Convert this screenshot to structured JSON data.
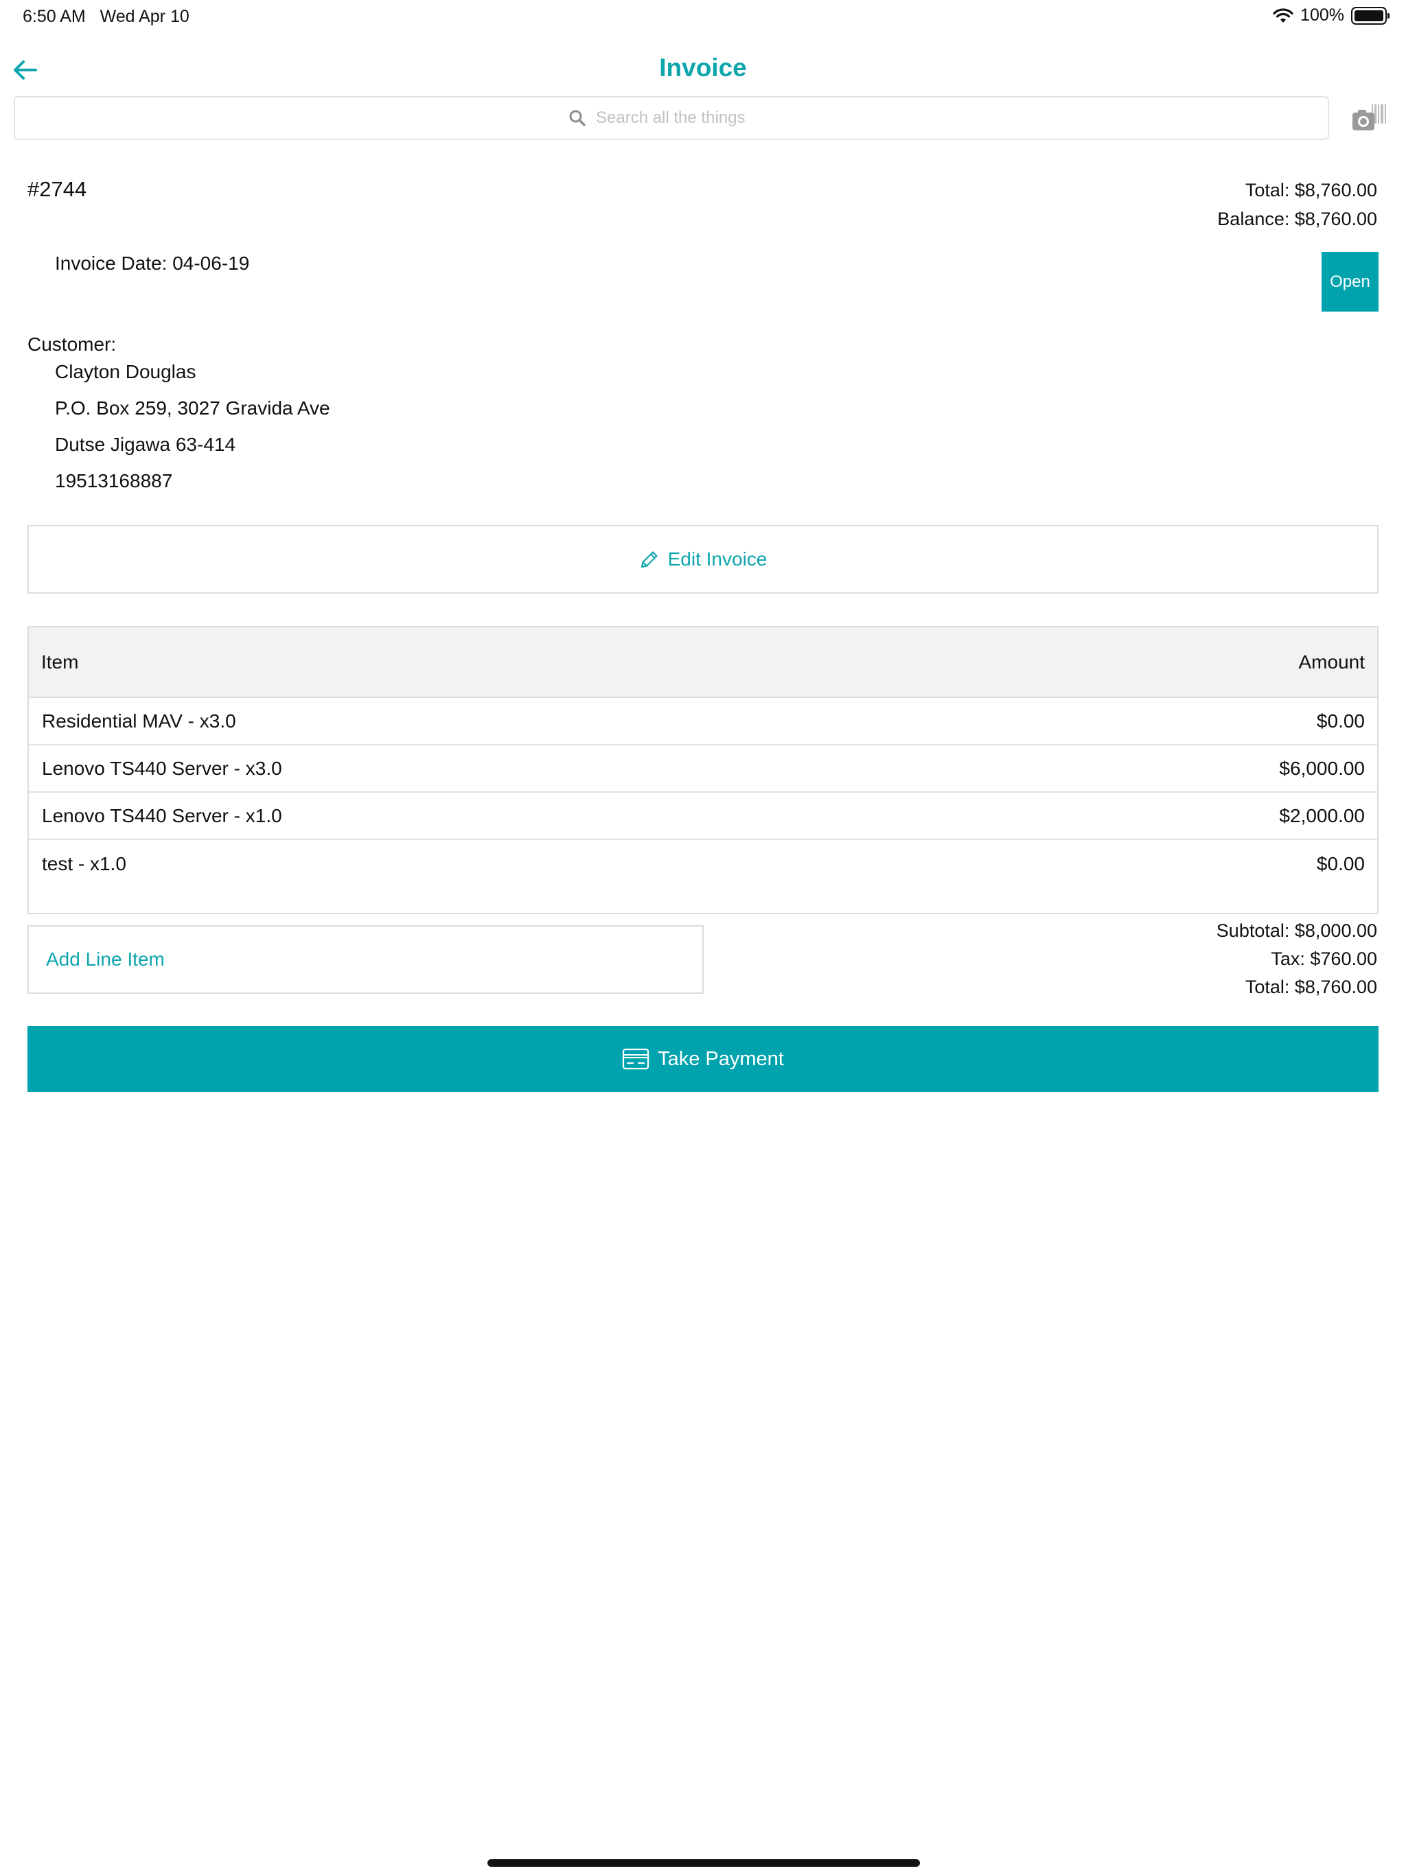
{
  "status_bar": {
    "time": "6:50 AM",
    "date": "Wed Apr 10",
    "battery": "100%"
  },
  "nav": {
    "title": "Invoice",
    "back_icon": "arrow-left-icon"
  },
  "search": {
    "placeholder": "Search all the things"
  },
  "invoice": {
    "number": "#2744",
    "total": "Total: $8,760.00",
    "balance": "Balance: $8,760.00",
    "date": "Invoice Date: 04-06-19",
    "status": "Open"
  },
  "customer": {
    "label": "Customer:",
    "name": "Clayton Douglas",
    "address1": "P.O. Box 259, 3027 Gravida Ave",
    "address2": "Dutse Jigawa 63-414",
    "phone": "19513168887"
  },
  "actions": {
    "edit_invoice": "Edit Invoice",
    "add_line_item": "Add Line Item",
    "take_payment": "Take Payment"
  },
  "table": {
    "headers": {
      "item": "Item",
      "amount": "Amount"
    },
    "rows": [
      {
        "item": "Residential MAV - x3.0",
        "amount": "$0.00"
      },
      {
        "item": "Lenovo TS440 Server - x3.0",
        "amount": "$6,000.00"
      },
      {
        "item": "Lenovo TS440 Server - x1.0",
        "amount": "$2,000.00"
      },
      {
        "item": "test - x1.0",
        "amount": "$0.00"
      }
    ]
  },
  "summary": {
    "subtotal": "Subtotal: $8,000.00",
    "tax": "Tax: $760.00",
    "total": "Total: $8,760.00"
  },
  "colors": {
    "accent": "#00a3ad",
    "accent_text": "#0ea5ad"
  }
}
